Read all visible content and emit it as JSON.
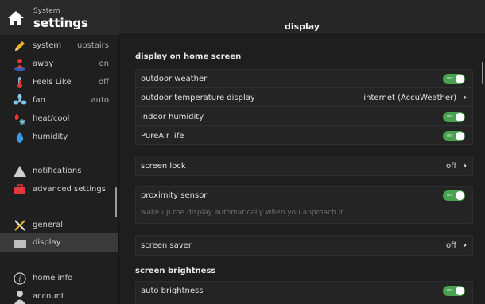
{
  "sidebar": {
    "header": {
      "subtitle": "System",
      "title": "settings"
    },
    "items": [
      {
        "label": "system",
        "value": "upstairs",
        "icon": "pencil-icon"
      },
      {
        "label": "away",
        "value": "on",
        "icon": "away-person-icon"
      },
      {
        "label": "Feels Like",
        "value": "off",
        "icon": "thermometer-icon"
      },
      {
        "label": "fan",
        "value": "auto",
        "icon": "fan-icon"
      },
      {
        "label": "heat/cool",
        "value": "",
        "icon": "flame-snowflake-icon"
      },
      {
        "label": "humidity",
        "value": "",
        "icon": "water-drop-icon"
      },
      {
        "label": "notifications",
        "value": "",
        "icon": "warning-triangle-icon"
      },
      {
        "label": "advanced settings",
        "value": "",
        "icon": "toolbox-icon"
      },
      {
        "label": "general",
        "value": "",
        "icon": "tools-icon"
      },
      {
        "label": "display",
        "value": "",
        "icon": "display-icon"
      },
      {
        "label": "home info",
        "value": "",
        "icon": "info-icon"
      },
      {
        "label": "account",
        "value": "",
        "icon": "person-icon"
      }
    ],
    "selected": "display"
  },
  "main": {
    "title": "display",
    "section1": {
      "title": "display on home screen",
      "rows": [
        {
          "label": "outdoor weather",
          "toggle": true,
          "toggle_label": "on"
        },
        {
          "label": "outdoor temperature display",
          "value": "internet (AccuWeather)"
        },
        {
          "label": "indoor humidity",
          "toggle": true,
          "toggle_label": "on"
        },
        {
          "label": "PureAir life",
          "toggle": true,
          "toggle_label": "on"
        }
      ]
    },
    "screen_lock": {
      "label": "screen lock",
      "value": "off"
    },
    "proximity": {
      "label": "proximity sensor",
      "toggle_label": "on",
      "description": "wake up the display automatically when you approach it"
    },
    "screen_saver": {
      "label": "screen saver",
      "value": "off"
    },
    "section2": {
      "title": "screen brightness",
      "rows": [
        {
          "label": "auto brightness",
          "toggle": true,
          "toggle_label": "on"
        }
      ]
    }
  },
  "colors": {
    "toggle_on": "#49a24f",
    "selected_bg": "#3a3a3a",
    "background": "#1e1e1e"
  }
}
